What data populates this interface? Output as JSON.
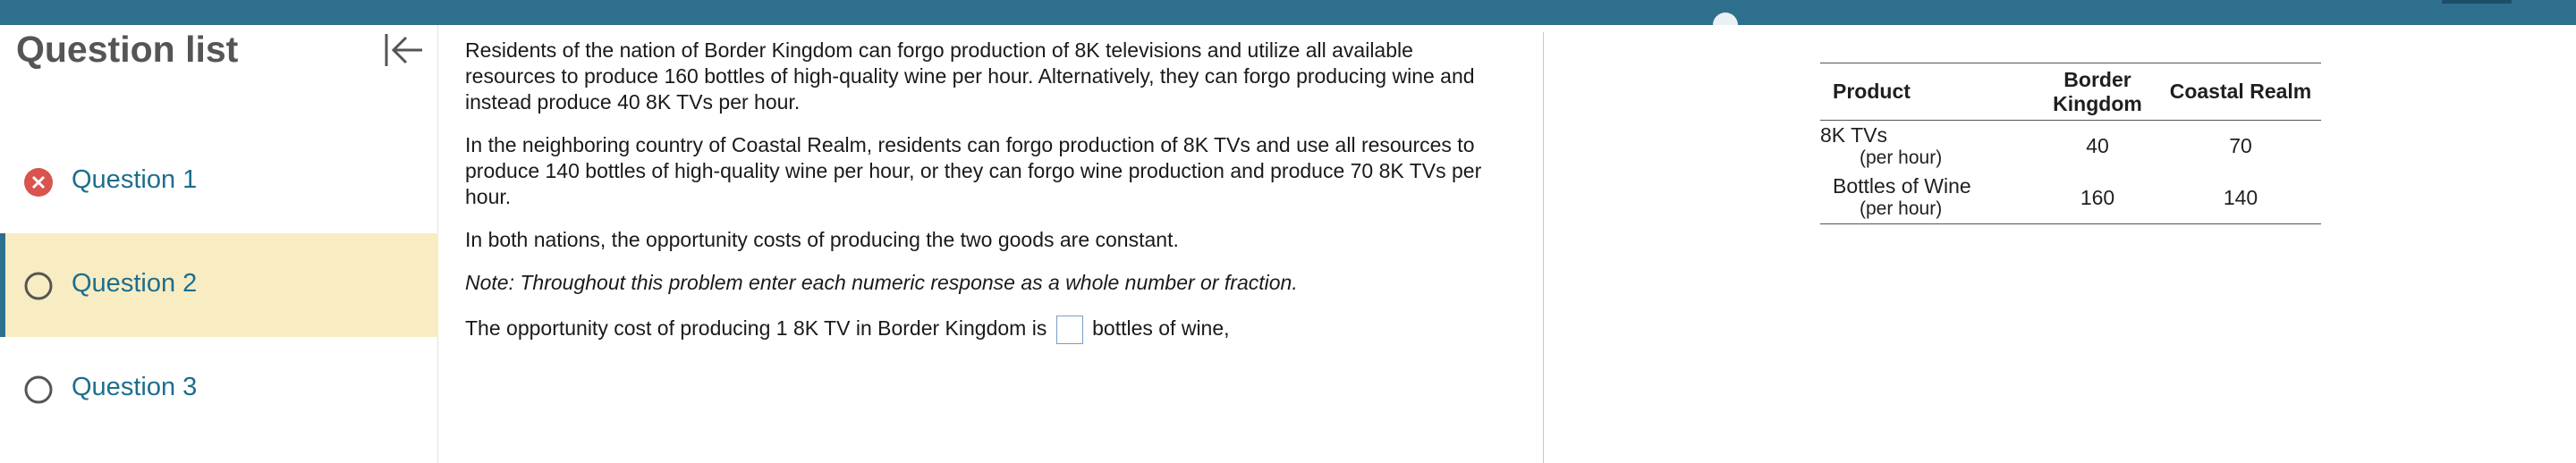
{
  "sidebar": {
    "title": "Question list",
    "questions": [
      {
        "label": "Question 1",
        "status": "incorrect"
      },
      {
        "label": "Question 2",
        "status": "current"
      },
      {
        "label": "Question 3",
        "status": "unanswered"
      }
    ]
  },
  "content": {
    "para1": "Residents of the nation of Border Kingdom can forgo production of 8K televisions and utilize all available resources to produce 160 bottles of high-quality wine per hour. Alternatively, they can forgo producing wine and instead produce 40 8K TVs per hour.",
    "para2": "In the neighboring country of Coastal Realm, residents can forgo production of 8K TVs and use all resources to produce 140 bottles of high-quality wine per hour, or they can forgo wine production and produce 70 8K TVs per hour.",
    "para3": "In both nations, the opportunity costs of producing the two goods are constant.",
    "note": "Note: Throughout this problem enter each numeric response as a whole number or fraction.",
    "question_prefix": "The opportunity cost of producing 1 8K TV in Border Kingdom is",
    "question_suffix": "bottles of wine,",
    "answer_value": ""
  },
  "table": {
    "headers": [
      "Product",
      "Border Kingdom",
      "Coastal Realm"
    ],
    "rows": [
      {
        "name": "8K TVs",
        "unit": "(per hour)",
        "border": "40",
        "coastal": "70"
      },
      {
        "name": "Bottles of Wine",
        "unit": "(per hour)",
        "border": "160",
        "coastal": "140"
      }
    ]
  },
  "colors": {
    "top_bar": "#2e6f8e",
    "active_question_bg": "#f8ecc2",
    "link_text": "#1d6e8d",
    "incorrect_icon": "#d9534f"
  },
  "icons": {
    "collapse": "collapse-left-icon",
    "incorrect": "x-circle-icon",
    "unanswered": "empty-circle-icon"
  }
}
